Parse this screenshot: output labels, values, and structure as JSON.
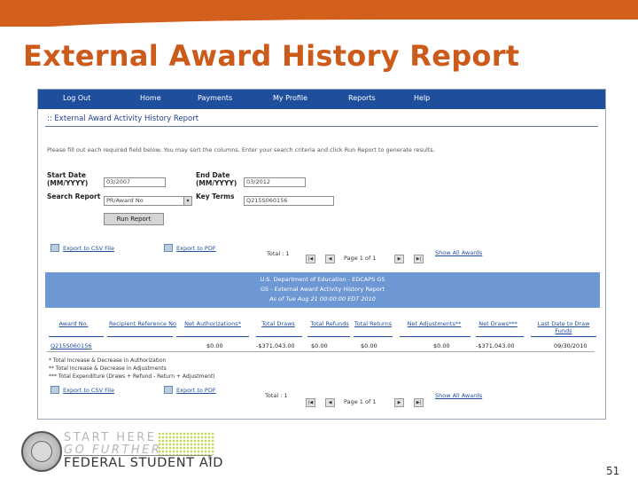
{
  "slide": {
    "title": "External Award History Report",
    "page_number": "51",
    "colors": {
      "title": "#cc5a1a",
      "top_bar": "#d2601c",
      "nav": "#1f4e9c",
      "banner": "#6d98d4"
    }
  },
  "nav": {
    "items": [
      "Log Out",
      "Home",
      "Payments",
      "My Profile",
      "Reports",
      "Help"
    ]
  },
  "report": {
    "heading": ":: External Award Activity History Report",
    "instructions": "Please fill out each required field below. You may sort the columns. Enter your search criteria and click Run Report to generate results.",
    "form": {
      "start_date_label": "Start Date (MM/YYYY)",
      "start_date_value": "03/2007",
      "end_date_label": "End Date (MM/YYYY)",
      "end_date_value": "03/2012",
      "search_report_label": "Search Report",
      "search_report_value": "PR/Award No",
      "key_terms_label": "Key Terms",
      "key_terms_value": "Q215S060156",
      "run_button": "Run Report"
    },
    "export_csv": "Export to CSV File",
    "export_pdf": "Export to PDF",
    "total": "Total : 1",
    "page_info": "Page 1 of 1",
    "show_all": "Show All Awards",
    "banner": {
      "line1": "U.S. Department of Education - EDCAPS G5",
      "line2": "G5 - External Award Activity History Report",
      "line3": "As of Tue Aug 21 00:00:00 EDT 2010"
    },
    "table": {
      "headers": [
        "Award No.",
        "Recipient Reference No",
        "Net Authorizations*",
        "Total Draws",
        "Total Refunds",
        "Total Returns",
        "Net Adjustments**",
        "Net Draws***",
        "Last Date to Draw Funds"
      ],
      "row": [
        "Q215S060156",
        "",
        "$0.00",
        "-$371,043.00",
        "$0.00",
        "$0.00",
        "$0.00",
        "-$371,043.00",
        "09/30/2010"
      ]
    },
    "footnotes": [
      "* Total Increase & Decrease in Authorization",
      "** Total Increase & Decrease in Adjustments",
      "*** Total Expenditure (Draws + Refund - Return + Adjustment)"
    ]
  },
  "logo": {
    "line1": "START HERE",
    "line2": "GO FURTHER",
    "line3": "FEDERAL STUDENT AID",
    "mark": "®"
  }
}
